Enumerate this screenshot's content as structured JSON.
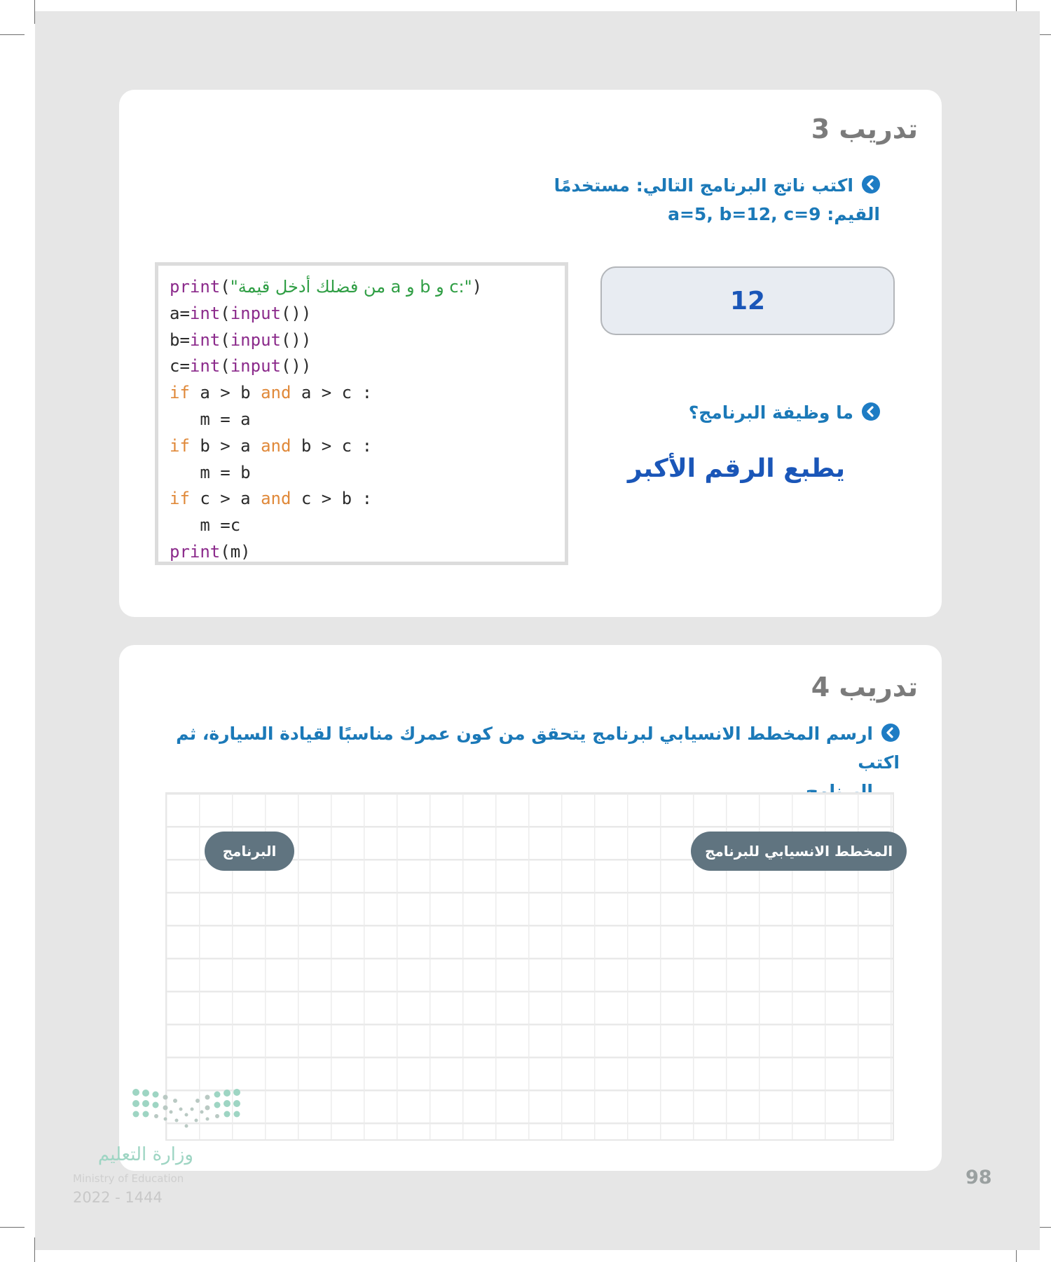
{
  "exercise3": {
    "title": "تدريب 3",
    "question1": {
      "line1": "اكتب ناتج البرنامج التالي: مستخدمًا",
      "line2": "القيم: a=5, b=12, c=9",
      "answer": "12"
    },
    "question2": {
      "text": "ما وظيفة البرنامج؟",
      "answer": "يطبع الرقم الأكبر"
    },
    "code": {
      "line1": {
        "func": "print",
        "open": "(",
        "string": "\"من فضلك أدخل قيمة a و b و c:\"",
        "close": ")"
      },
      "line2": {
        "var": "a=",
        "f1": "int",
        "p1": "(",
        "f2": "input",
        "rest": "())"
      },
      "line3": {
        "var": "b=",
        "f1": "int",
        "p1": "(",
        "f2": "input",
        "rest": "())"
      },
      "line4": {
        "var": "c=",
        "f1": "int",
        "p1": "(",
        "f2": "input",
        "rest": "())"
      },
      "line5": {
        "kw": "if",
        "cond1": " a > b ",
        "op": "and",
        "cond2": " a > c :"
      },
      "line6": {
        "text": "   m = a"
      },
      "line7": {
        "kw": "if",
        "cond1": " b > a ",
        "op": "and",
        "cond2": " b > c :"
      },
      "line8": {
        "text": "   m = b"
      },
      "line9": {
        "kw": "if",
        "cond1": " c > a ",
        "op": "and",
        "cond2": " c > b :"
      },
      "line10": {
        "text": "   m =c"
      },
      "line11": {
        "func": "print",
        "rest": "(m)"
      }
    }
  },
  "exercise4": {
    "title": "تدريب 4",
    "question": {
      "line1": "ارسم المخطط الانسيابي لبرنامج يتحقق من كون عمرك مناسبًا لقيادة السيارة، ثم اكتب",
      "line2": "البرنامج."
    },
    "labels": {
      "flowchart": "المخطط الانسيابي للبرنامج",
      "program": "البرنامج"
    }
  },
  "footer": {
    "logo_ar": "وزارة التعليم",
    "logo_en": "Ministry of Education",
    "year": "2022 - 1444",
    "page_number": "98"
  },
  "colors": {
    "question_blue": "#1b79b8",
    "answer_blue": "#1a56b8",
    "pill_gray": "#607480",
    "title_gray": "#7b7b7b",
    "page_bg": "#e6e6e6"
  },
  "icons": {
    "bullet": "chevron-left-circle-icon",
    "logo": "ministry-dots-logo-icon"
  }
}
